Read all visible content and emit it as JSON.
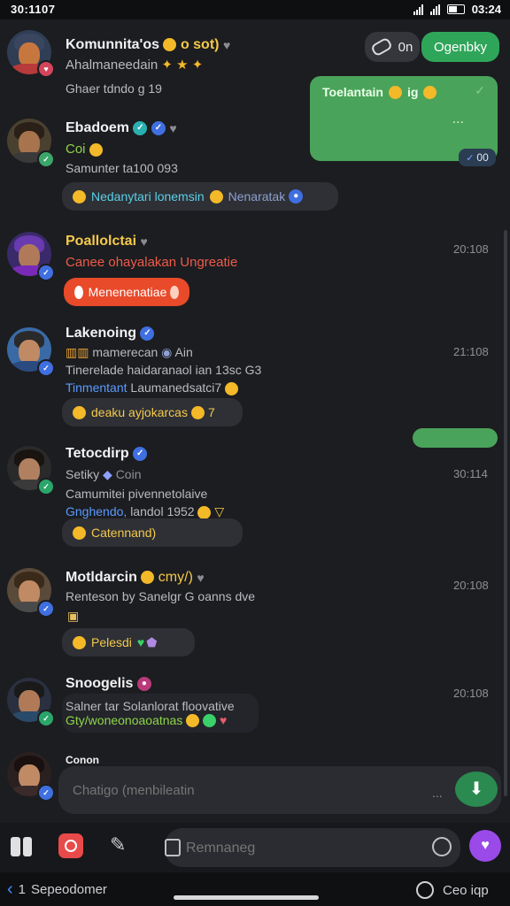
{
  "status": {
    "time": "30:1107",
    "right_time": "03:24"
  },
  "top_actions": {
    "ghost_label": "0n",
    "primary_label": "Ogenbky"
  },
  "right_bubble": {
    "text": "Toelantain",
    "tag": "ig",
    "dots": "...",
    "counter": "00"
  },
  "feed": [
    {
      "name": "Komunnita'os",
      "name_suffix": "o sot)",
      "line1": "Ahalmaneedain",
      "line2": "Ghaer tdndo g 19",
      "avatar_color": "#c7773e",
      "badge_color": "#d4455c"
    },
    {
      "name": "Ebadoem",
      "line1": "Coi",
      "line2": "Samunter ta100 093",
      "pill": "Nedanytari lonemsin",
      "pill_tail": "Nenaratak",
      "avatar_color": "#7a5a3e",
      "badge_color": "#3aa66a"
    },
    {
      "name": "Poallolctai",
      "line1": "Canee ohayalakan Ungreatie",
      "time": "20:108",
      "pill": "Menenenatiae",
      "avatar_color": "#5a3aa6",
      "badge_color": "#3f6fe0"
    },
    {
      "name": "Lakenoing",
      "line1": "mamerecan",
      "line1_tail": "Ain",
      "line2": "Tinerelade haidaranaol ian 13sc G3",
      "line3": "Tinmentant",
      "line3_tail": "Laumanedsatci7",
      "time": "21:108",
      "pill": "deaku ayjokarcas",
      "pill_tail": "7",
      "avatar_color": "#3a6aa6",
      "badge_color": "#3f6fe0"
    },
    {
      "name": "Tetocdirp",
      "line1": "Setiky",
      "line1_tail": "Coin",
      "line2": "Camumitei pivennetolaive",
      "line3": "Gnghendo,",
      "line3_tail": "landol 1952",
      "time": "30:114",
      "pill": "Catennand)",
      "avatar_color": "#4a3a30",
      "badge_color": "#2aa66a"
    },
    {
      "name": "Motldarcin",
      "name_suffix": "cmy/)",
      "line1": "Renteson by Sanelgr G oanns dve",
      "time": "20:108",
      "pill": "Pelesdi",
      "avatar_color": "#8a5a3a",
      "badge_color": "#3f6fe0"
    },
    {
      "name": "Snoogelis",
      "line1": "Salner tar Solanlorat floovative",
      "line2": "Gty/woneonoaoatnas",
      "time": "20:108",
      "avatar_color": "#3a4a6a",
      "badge_color": "#2aa66a"
    },
    {
      "name": "Conon",
      "avatar_color": "#5a3a30",
      "badge_color": "#3f6fe0"
    }
  ],
  "compose": {
    "placeholder": "Chatigo (menbileatin",
    "dots": "..."
  },
  "bottom": {
    "search_placeholder": "Remnaneg"
  },
  "nav": {
    "back_label": "Sepeodomer",
    "right_label": "Ceo iqp"
  }
}
